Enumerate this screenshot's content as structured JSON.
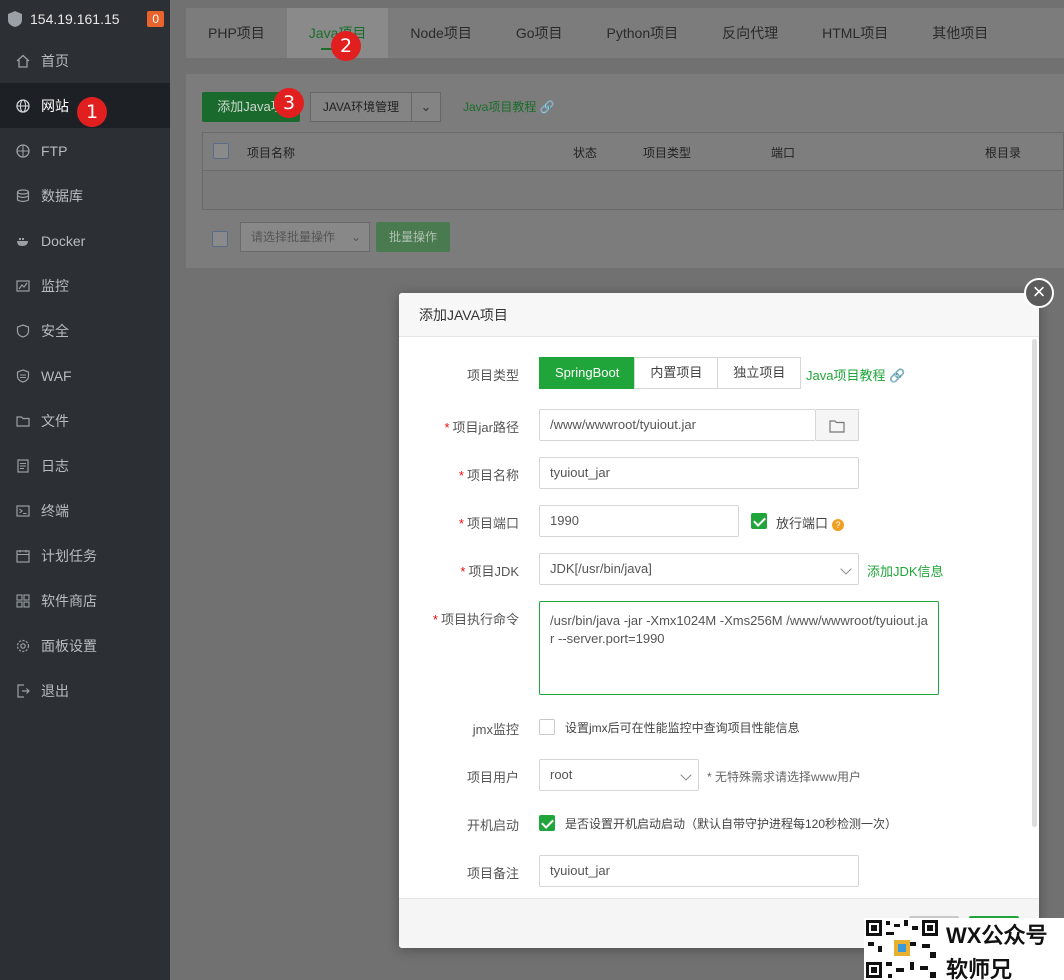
{
  "sidebar": {
    "server_ip": "154.19.161.15",
    "alert_count": "0",
    "items": [
      {
        "label": "首页",
        "icon": "home-icon"
      },
      {
        "label": "网站",
        "icon": "globe-icon"
      },
      {
        "label": "FTP",
        "icon": "ftp-icon"
      },
      {
        "label": "数据库",
        "icon": "database-icon"
      },
      {
        "label": "Docker",
        "icon": "docker-icon"
      },
      {
        "label": "监控",
        "icon": "monitor-icon"
      },
      {
        "label": "安全",
        "icon": "shield-icon"
      },
      {
        "label": "WAF",
        "icon": "waf-icon"
      },
      {
        "label": "文件",
        "icon": "folder-icon"
      },
      {
        "label": "日志",
        "icon": "log-icon"
      },
      {
        "label": "终端",
        "icon": "terminal-icon"
      },
      {
        "label": "计划任务",
        "icon": "calendar-icon"
      },
      {
        "label": "软件商店",
        "icon": "grid-icon"
      },
      {
        "label": "面板设置",
        "icon": "gear-icon"
      },
      {
        "label": "退出",
        "icon": "logout-icon"
      }
    ]
  },
  "tabs": [
    "PHP项目",
    "Java项目",
    "Node项目",
    "Go项目",
    "Python项目",
    "反向代理",
    "HTML项目",
    "其他项目"
  ],
  "toolbar": {
    "add_label": "添加Java项目",
    "env_label": "JAVA环境管理",
    "tutorial_label": "Java项目教程"
  },
  "table": {
    "headers": [
      "项目名称",
      "状态",
      "项目类型",
      "端口",
      "根目录"
    ]
  },
  "batch": {
    "select_placeholder": "请选择批量操作",
    "button_label": "批量操作"
  },
  "markers": [
    "1",
    "2",
    "3"
  ],
  "dialog": {
    "title": "添加JAVA项目",
    "project_type": {
      "label": "项目类型",
      "options": [
        "SpringBoot",
        "内置项目",
        "独立项目"
      ],
      "selected": "SpringBoot",
      "tutorial": "Java项目教程"
    },
    "jar_path": {
      "label": "项目jar路径",
      "value": "/www/wwwroot/tyuiout.jar"
    },
    "name": {
      "label": "项目名称",
      "value": "tyuiout_jar"
    },
    "port": {
      "label": "项目端口",
      "value": "1990",
      "open_port_label": "放行端口",
      "open_port_checked": true
    },
    "jdk": {
      "label": "项目JDK",
      "value": "JDK[/usr/bin/java]",
      "add_link": "添加JDK信息"
    },
    "command": {
      "label": "项目执行命令",
      "value": "/usr/bin/java  -jar -Xmx1024M -Xms256M  /www/wwwroot/tyuiout.jar --server.port=1990"
    },
    "jmx": {
      "label": "jmx监控",
      "text": "设置jmx后可在性能监控中查询项目性能信息",
      "checked": false
    },
    "user": {
      "label": "项目用户",
      "value": "root",
      "hint": "* 无特殊需求请选择www用户"
    },
    "autostart": {
      "label": "开机启动",
      "text": "是否设置开机启动启动（默认自带守护进程每120秒检测一次）",
      "checked": true
    },
    "remark": {
      "label": "项目备注",
      "value": "tyuiout_jar"
    }
  },
  "watermark": {
    "line1": "WX公众号",
    "line2": "软师兄"
  },
  "colors": {
    "accent": "#20a53a",
    "marker": "#e21f1f",
    "sidebar": "#2c2f33"
  }
}
